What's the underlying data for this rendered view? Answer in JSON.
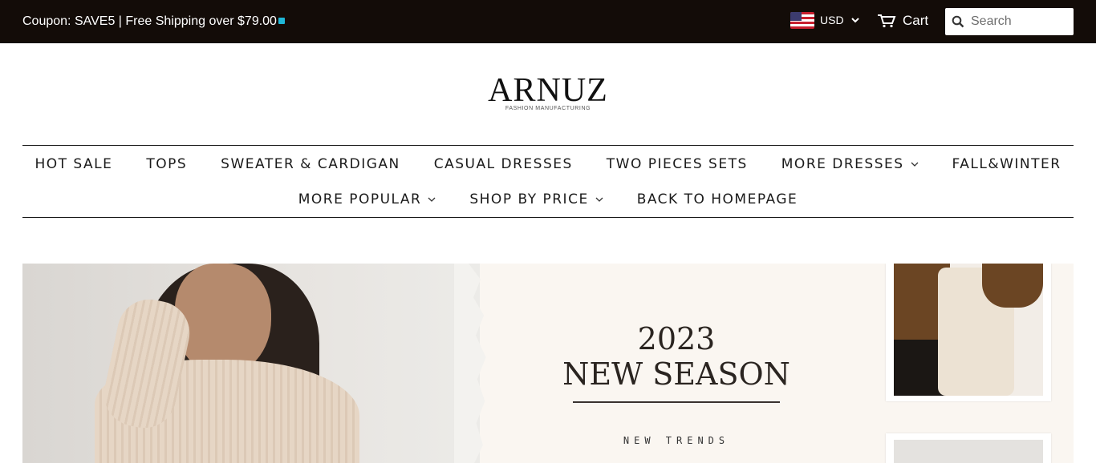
{
  "topbar": {
    "coupon_text": "Coupon: SAVE5 | Free Shipping over $79.00",
    "currency": "USD",
    "currency_flag": "us-flag-icon",
    "cart_label": "Cart",
    "search_placeholder": "Search"
  },
  "brand": {
    "name": "ARNUZ",
    "tagline": "FASHION MANUFACTURING"
  },
  "nav": {
    "row1": [
      {
        "label": "HOT SALE",
        "has_dropdown": false
      },
      {
        "label": "TOPS",
        "has_dropdown": false
      },
      {
        "label": "SWEATER & CARDIGAN",
        "has_dropdown": false
      },
      {
        "label": "CASUAL DRESSES",
        "has_dropdown": false
      },
      {
        "label": "TWO PIECES SETS",
        "has_dropdown": false
      },
      {
        "label": "MORE DRESSES",
        "has_dropdown": true
      },
      {
        "label": "FALL&WINTER",
        "has_dropdown": false
      }
    ],
    "row2": [
      {
        "label": "MORE POPULAR",
        "has_dropdown": true
      },
      {
        "label": "SHOP BY PRICE",
        "has_dropdown": true
      },
      {
        "label": "BACK TO HOMEPAGE",
        "has_dropdown": false
      }
    ]
  },
  "hero": {
    "year": "2023",
    "title": "NEW SEASON",
    "subtitle": "NEW TRENDS"
  },
  "colors": {
    "topbar_bg": "#130c08",
    "hero_bg": "#faf6f1",
    "accent_chat": "#1fb7d6"
  }
}
